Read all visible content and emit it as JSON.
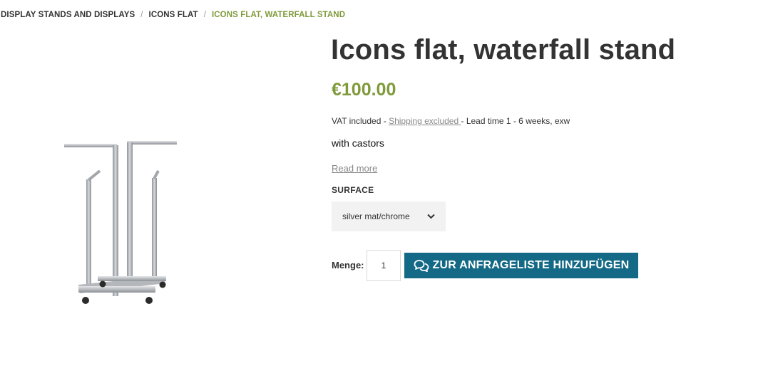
{
  "breadcrumb": {
    "items": [
      "DISPLAY STANDS AND DISPLAYS",
      "ICONS FLAT"
    ],
    "separator": "/",
    "current": "ICONS FLAT, WATERFALL STAND"
  },
  "product": {
    "title": "Icons flat, waterfall stand",
    "price": "€100.00",
    "tax": {
      "vat": "VAT included -",
      "shipping_link": "Shipping excluded ",
      "lead_time": "- Lead time 1 - 6 weeks, exw"
    },
    "short_description": "with castors",
    "read_more": "Read more",
    "image_icon": "clothing-rack-image"
  },
  "options": {
    "surface_label": "SURFACE",
    "surface_value": "silver mat/chrome"
  },
  "cart": {
    "quantity_label": "Menge:",
    "quantity_value": "1",
    "add_button_label": "ZUR ANFRAGELISTE HINZUFÜGEN",
    "add_button_icon": "chat-bubbles-icon"
  },
  "colors": {
    "accent_green": "#7f9a3b",
    "button_blue": "#136986",
    "text": "#333333"
  }
}
